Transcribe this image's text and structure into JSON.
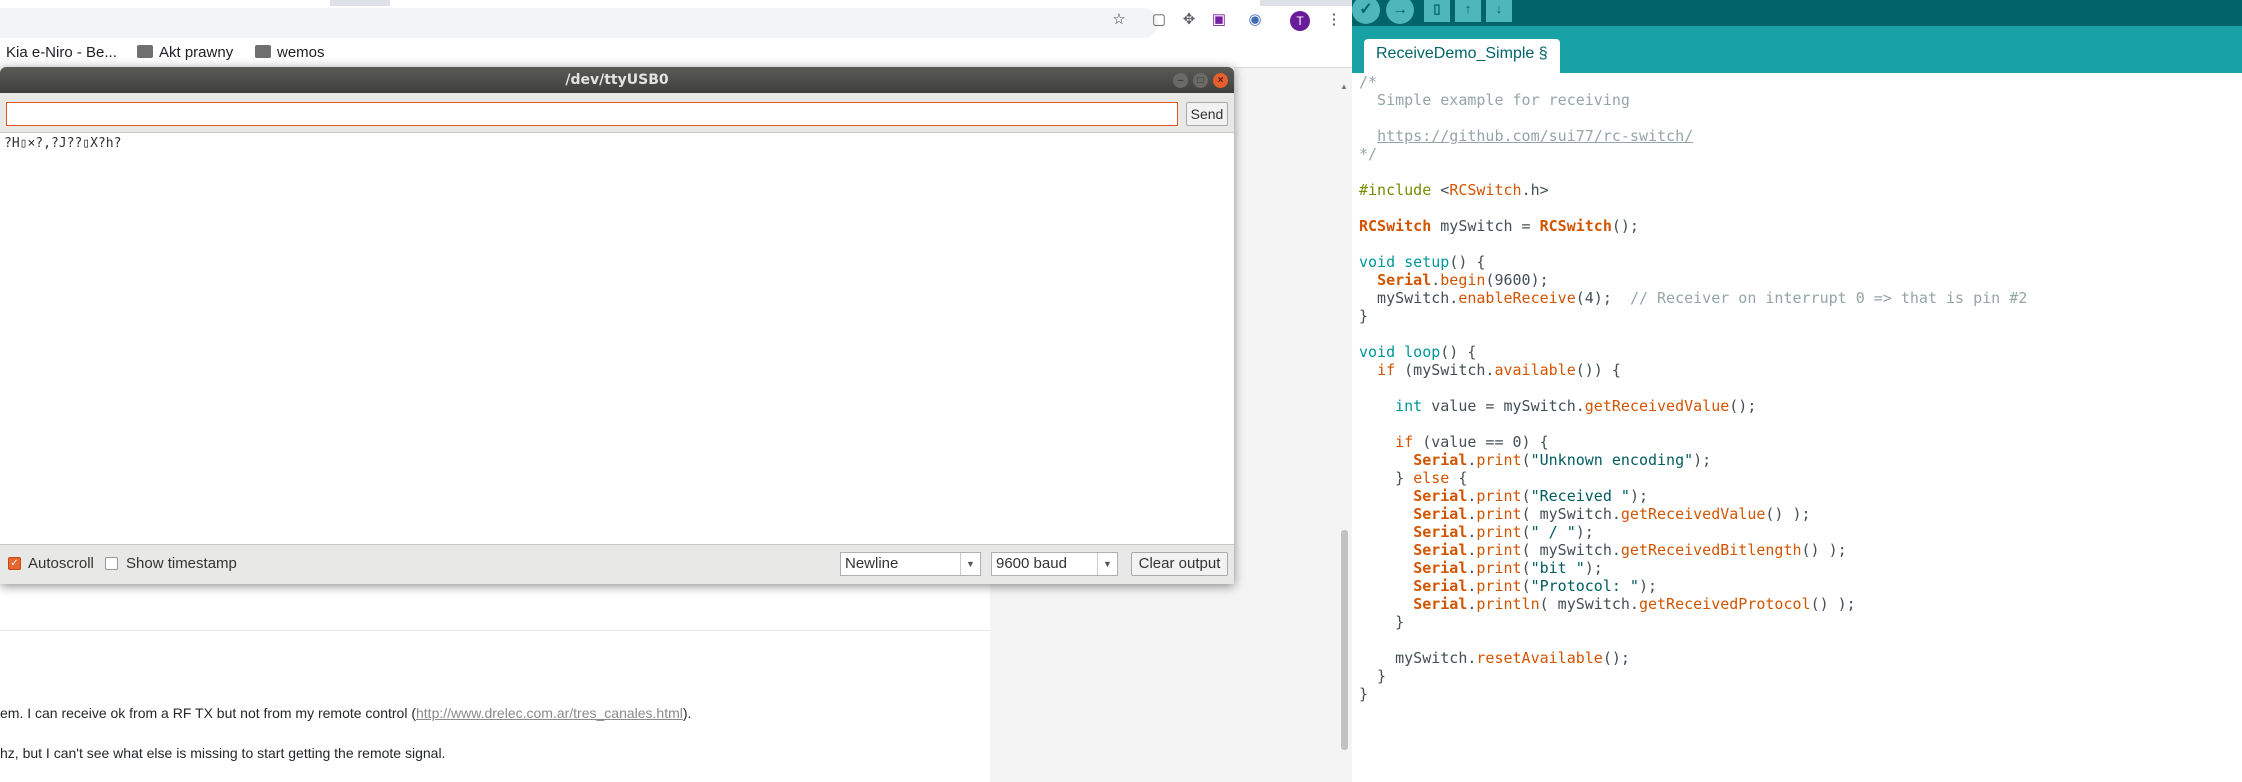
{
  "browser": {
    "bookmarks": [
      {
        "label": "Kia e-Niro - Be..."
      },
      {
        "label": "Akt prawny"
      },
      {
        "label": "wemos"
      }
    ],
    "avatar_letter": "T",
    "post_lines": [
      {
        "before": "em. I can receive ok from a RF TX but not from my remote control (",
        "link": "http://www.drelec.com.ar/tres_canales.html",
        "after": ")."
      },
      {
        "before": "hz, but I can't see what else is missing to start getting the remote signal.",
        "link": "",
        "after": ""
      }
    ]
  },
  "serial_monitor": {
    "title": "/dev/ttyUSB0",
    "input_value": "",
    "send_label": "Send",
    "output": "?H▯×?,?J??▯X?h?",
    "autoscroll_label": "Autoscroll",
    "autoscroll_checked": true,
    "show_timestamp_label": "Show timestamp",
    "show_timestamp_checked": false,
    "line_ending": "Newline",
    "baud_rate": "9600 baud",
    "clear_output_label": "Clear output"
  },
  "ide": {
    "tab_label": "ReceiveDemo_Simple §",
    "code": [
      [
        {
          "t": "/*",
          "c": "com"
        }
      ],
      [
        {
          "t": "  Simple example for receiving",
          "c": "com"
        }
      ],
      [],
      [
        {
          "t": "  ",
          "c": "com"
        },
        {
          "t": "https://github.com/sui77/rc-switch/",
          "c": "link"
        }
      ],
      [
        {
          "t": "*/",
          "c": "com"
        }
      ],
      [],
      [
        {
          "t": "#include ",
          "c": "pp"
        },
        {
          "t": "<"
        },
        {
          "t": "RCSwitch",
          "c": "fn"
        },
        {
          "t": ".h>"
        }
      ],
      [],
      [
        {
          "t": "RCSwitch",
          "c": "cls"
        },
        {
          "t": " mySwitch = "
        },
        {
          "t": "RCSwitch",
          "c": "cls"
        },
        {
          "t": "();"
        }
      ],
      [],
      [
        {
          "t": "void",
          "c": "kw"
        },
        {
          "t": " "
        },
        {
          "t": "setup",
          "c": "kw"
        },
        {
          "t": "() {"
        }
      ],
      [
        {
          "t": "  "
        },
        {
          "t": "Serial",
          "c": "cls"
        },
        {
          "t": "."
        },
        {
          "t": "begin",
          "c": "fn"
        },
        {
          "t": "(9600);"
        }
      ],
      [
        {
          "t": "  mySwitch."
        },
        {
          "t": "enableReceive",
          "c": "fn"
        },
        {
          "t": "(4);  "
        },
        {
          "t": "// Receiver on interrupt 0 => that is pin #2",
          "c": "com"
        }
      ],
      [
        {
          "t": "}"
        }
      ],
      [],
      [
        {
          "t": "void",
          "c": "kw"
        },
        {
          "t": " "
        },
        {
          "t": "loop",
          "c": "kw"
        },
        {
          "t": "() {"
        }
      ],
      [
        {
          "t": "  "
        },
        {
          "t": "if",
          "c": "fn"
        },
        {
          "t": " (mySwitch."
        },
        {
          "t": "available",
          "c": "fn"
        },
        {
          "t": "()) {"
        }
      ],
      [],
      [
        {
          "t": "    "
        },
        {
          "t": "int",
          "c": "kw"
        },
        {
          "t": " value = mySwitch."
        },
        {
          "t": "getReceivedValue",
          "c": "fn"
        },
        {
          "t": "();"
        }
      ],
      [],
      [
        {
          "t": "    "
        },
        {
          "t": "if",
          "c": "fn"
        },
        {
          "t": " (value == 0) {"
        }
      ],
      [
        {
          "t": "      "
        },
        {
          "t": "Serial",
          "c": "cls"
        },
        {
          "t": "."
        },
        {
          "t": "print",
          "c": "fn"
        },
        {
          "t": "("
        },
        {
          "t": "\"Unknown encoding\"",
          "c": "str"
        },
        {
          "t": ");"
        }
      ],
      [
        {
          "t": "    } "
        },
        {
          "t": "else",
          "c": "fn"
        },
        {
          "t": " {"
        }
      ],
      [
        {
          "t": "      "
        },
        {
          "t": "Serial",
          "c": "cls"
        },
        {
          "t": "."
        },
        {
          "t": "print",
          "c": "fn"
        },
        {
          "t": "("
        },
        {
          "t": "\"Received \"",
          "c": "str"
        },
        {
          "t": ");"
        }
      ],
      [
        {
          "t": "      "
        },
        {
          "t": "Serial",
          "c": "cls"
        },
        {
          "t": "."
        },
        {
          "t": "print",
          "c": "fn"
        },
        {
          "t": "( mySwitch."
        },
        {
          "t": "getReceivedValue",
          "c": "fn"
        },
        {
          "t": "() );"
        }
      ],
      [
        {
          "t": "      "
        },
        {
          "t": "Serial",
          "c": "cls"
        },
        {
          "t": "."
        },
        {
          "t": "print",
          "c": "fn"
        },
        {
          "t": "("
        },
        {
          "t": "\" / \"",
          "c": "str"
        },
        {
          "t": ");"
        }
      ],
      [
        {
          "t": "      "
        },
        {
          "t": "Serial",
          "c": "cls"
        },
        {
          "t": "."
        },
        {
          "t": "print",
          "c": "fn"
        },
        {
          "t": "( mySwitch."
        },
        {
          "t": "getReceivedBitlength",
          "c": "fn"
        },
        {
          "t": "() );"
        }
      ],
      [
        {
          "t": "      "
        },
        {
          "t": "Serial",
          "c": "cls"
        },
        {
          "t": "."
        },
        {
          "t": "print",
          "c": "fn"
        },
        {
          "t": "("
        },
        {
          "t": "\"bit \"",
          "c": "str"
        },
        {
          "t": ");"
        }
      ],
      [
        {
          "t": "      "
        },
        {
          "t": "Serial",
          "c": "cls"
        },
        {
          "t": "."
        },
        {
          "t": "print",
          "c": "fn"
        },
        {
          "t": "("
        },
        {
          "t": "\"Protocol: \"",
          "c": "str"
        },
        {
          "t": ");"
        }
      ],
      [
        {
          "t": "      "
        },
        {
          "t": "Serial",
          "c": "cls"
        },
        {
          "t": "."
        },
        {
          "t": "println",
          "c": "fn"
        },
        {
          "t": "( mySwitch."
        },
        {
          "t": "getReceivedProtocol",
          "c": "fn"
        },
        {
          "t": "() );"
        }
      ],
      [
        {
          "t": "    }"
        }
      ],
      [],
      [
        {
          "t": "    mySwitch."
        },
        {
          "t": "resetAvailable",
          "c": "fn"
        },
        {
          "t": "();"
        }
      ],
      [
        {
          "t": "  }"
        }
      ],
      [
        {
          "t": "}"
        }
      ]
    ]
  }
}
